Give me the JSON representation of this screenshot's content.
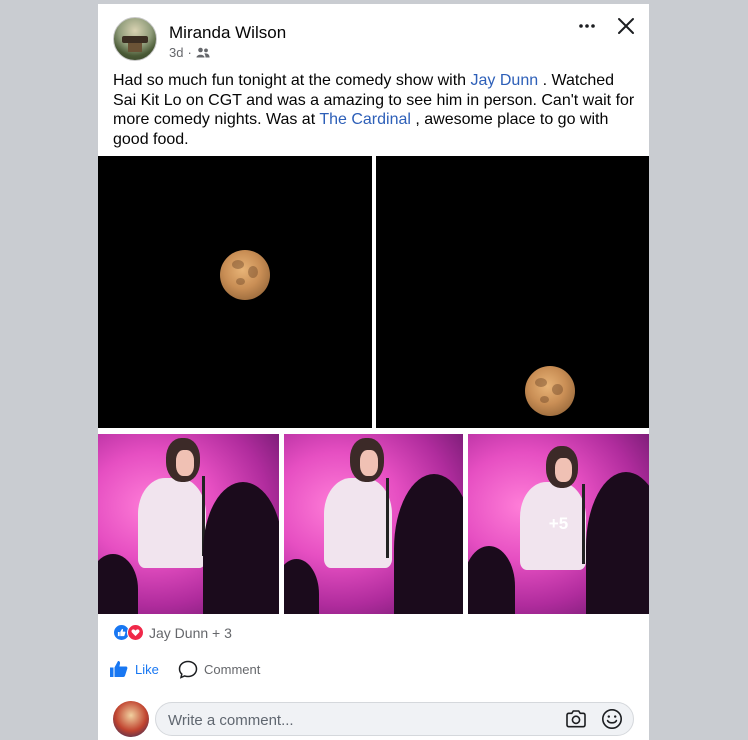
{
  "post": {
    "author": "Miranda Wilson",
    "time": "3d",
    "separator": "·",
    "text_parts": [
      "Had so much fun tonight at the comedy show with ",
      "Jay Dunn",
      " . Watched Sai Kit Lo on CGT and was a amazing to see him in person. Can't wait for more comedy nights. Was at  ",
      "The Cardinal",
      " , awesome place to go with good food."
    ],
    "more_photos": "+5"
  },
  "reactions": {
    "summary": "Jay Dunn + 3",
    "types": [
      "like",
      "love"
    ]
  },
  "actions": {
    "like": "Like",
    "comment": "Comment"
  },
  "comment_input": {
    "placeholder": "Write a comment..."
  },
  "colors": {
    "link": "#2d5fb8",
    "accent": "#1877f2",
    "love": "#f02849"
  },
  "icons": [
    "more-icon",
    "close-icon",
    "friends-icon",
    "like-icon",
    "comment-icon",
    "camera-icon",
    "emoji-icon"
  ]
}
